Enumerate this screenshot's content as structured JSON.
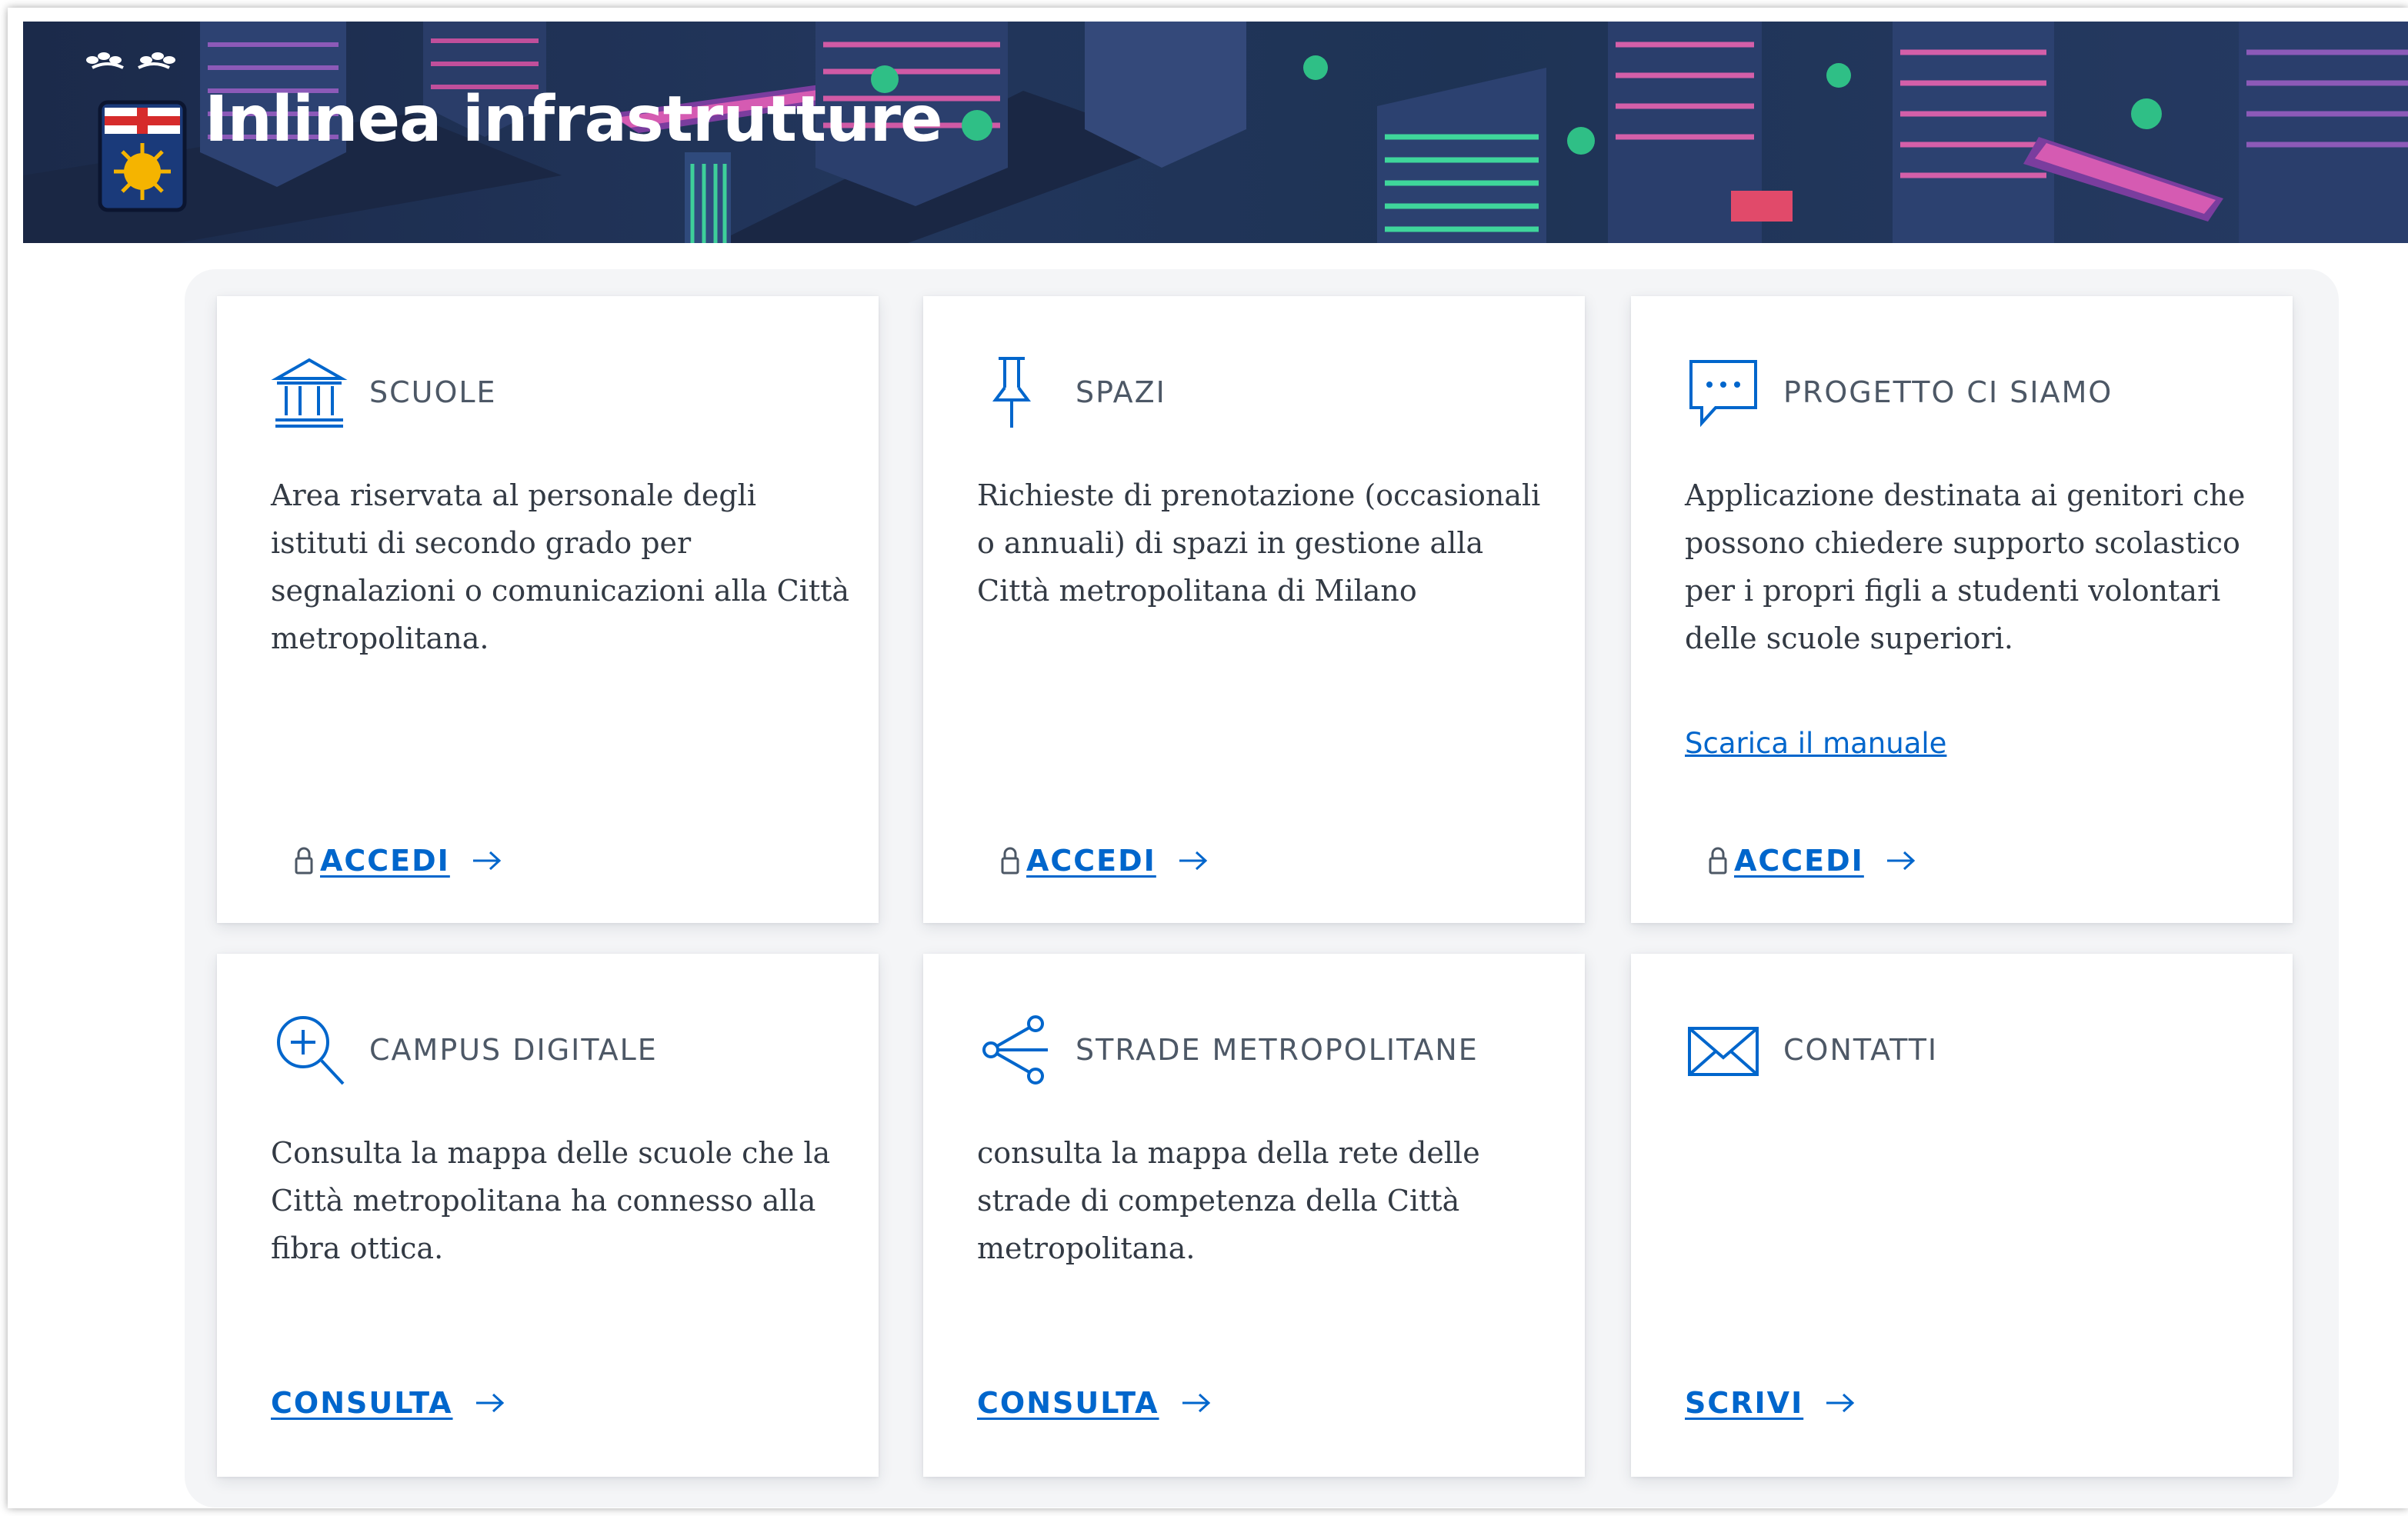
{
  "header": {
    "site_title": "Inlinea infrastrutture"
  },
  "cards": [
    {
      "title": "SCUOLE",
      "icon": "institution-icon",
      "text": "Area riservata al personale degli istituti di secondo grado per segnalazioni o comunicazioni alla Città metropolitana.",
      "action": "ACCEDI",
      "action_locked": true
    },
    {
      "title": "SPAZI",
      "icon": "pin-icon",
      "text": "Richieste di prenotazione (occasionali o annuali) di spazi in gestione alla Città metropolitana di Milano",
      "action": "ACCEDI",
      "action_locked": true
    },
    {
      "title": "PROGETTO CI SIAMO",
      "icon": "chat-bubble-icon",
      "text": "Applicazione destinata ai genitori che possono chiedere supporto scolastico per i propri figli a studenti volontari delle scuole superiori.",
      "link": "Scarica il manuale",
      "action": "ACCEDI",
      "action_locked": true
    },
    {
      "title": "CAMPUS DIGITALE",
      "icon": "zoom-in-icon",
      "text": "Consulta la mappa delle scuole che la Città metropolitana ha connesso alla fibra ottica.",
      "action": "CONSULTA",
      "action_locked": false
    },
    {
      "title": "STRADE METROPOLITANE",
      "icon": "share-icon",
      "text": "consulta la mappa della rete delle strade di competenza della Città metropolitana.",
      "action": "CONSULTA",
      "action_locked": false
    },
    {
      "title": "CONTATTI",
      "icon": "envelope-icon",
      "text": "",
      "action": "SCRIVI",
      "action_locked": false
    }
  ],
  "colors": {
    "primary": "#0066cc",
    "title_text": "#4d5866",
    "body_text": "#333a44",
    "banner_bg": "#1e3355"
  }
}
